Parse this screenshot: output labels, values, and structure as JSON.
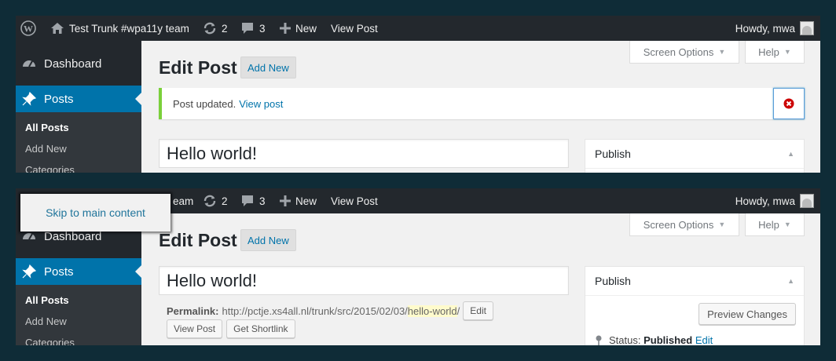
{
  "admin_bar": {
    "site_name": "Test Trunk #wpa11y team",
    "site_name_partial": "eam",
    "updates_count": "2",
    "comments_count": "3",
    "new_label": "New",
    "view_post_label": "View Post",
    "howdy": "Howdy, mwa"
  },
  "sidebar": {
    "dashboard": "Dashboard",
    "posts": "Posts",
    "sub_items": [
      "All Posts",
      "Add New",
      "Categories"
    ]
  },
  "screen_options": "Screen Options",
  "help": "Help",
  "page": {
    "title": "Edit Post",
    "add_new": "Add New"
  },
  "notice": {
    "text": "Post updated.",
    "link": "View post"
  },
  "post": {
    "title": "Hello world!"
  },
  "publish": {
    "heading": "Publish",
    "preview_changes": "Preview Changes",
    "status_label": "Status:",
    "status_value": "Published",
    "status_edit": "Edit"
  },
  "permalink": {
    "label": "Permalink:",
    "base": "http://pctje.xs4all.nl/trunk/src/2015/02/03/",
    "slug": "hello-world",
    "trailing": "/",
    "edit_button": "Edit",
    "view_post_button": "View Post",
    "get_shortlink_button": "Get Shortlink"
  },
  "skip_link": "Skip to main content",
  "colors": {
    "admin_bar_bg": "#23282d",
    "menu_active": "#0073aa",
    "link": "#0073aa",
    "notice_success": "#7ad03a",
    "background": "#0f2c37"
  }
}
